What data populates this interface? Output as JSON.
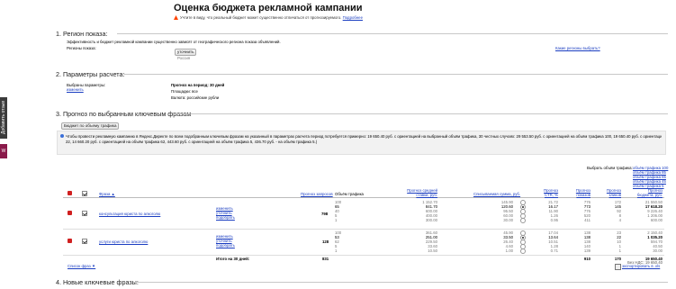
{
  "page": {
    "title": "Оценка бюджета рекламной кампании",
    "warning_text": "Учтите в виду, что реальный бюджет может существенно отличаться от прогнозируемого.",
    "warning_link": "Подробнее"
  },
  "side_tabs": {
    "feedback": "Добавить отзыв",
    "badge": "W"
  },
  "region": {
    "heading": "1. Регион показа:",
    "description": "Эффективность и бюджет рекламной кампании существенно зависят от географического региона показа объявлений.",
    "label": "Регионы показа:",
    "refine_btn": "уточнить",
    "value": "Россия",
    "right_link": "Какие регионы выбрать?"
  },
  "params": {
    "heading": "2. Параметры расчета:",
    "selected_label": "Выбраны параметры:",
    "change_link": "изменить",
    "forecast_period": "Прогноз на период: 30 дней",
    "platforms": "Площадки: все",
    "currency": "Валюта: российские рубли"
  },
  "forecast": {
    "heading": "3. Прогноз по выбранным ключевым фразам",
    "by_traffic_btn": "Бюджет по объему трафика",
    "notice_line1": "Чтобы провести рекламную кампанию в Яндекс.Директе по всем подобранным ключевым фразам на указанный в параметрах расчета период потребуется примерно: 19 650.40 руб. с ориентацией на выбранный объём трафика, 30 честных случаях: 29 553.50 руб. с ориентацией на объём трафика 100, 19 650.40 руб. с ориентацией на объём трафика",
    "notice_line2": "22, 14 660.20 руб. с ориентацией на объём трафика 62, 443.60 руб. с ориентацией на объём трафика 5, 436.70 руб. - на объём трафика 5.)",
    "choose_traffic_label": "Выбрать объём трафика:",
    "traffic_links": [
      "объём трафика 100",
      "объём трафика 85",
      "объём трафика 65",
      "объём трафика 45",
      "объём трафика 5"
    ],
    "columns": {
      "phrase": "Фраза ▲",
      "searches": "Прогноз запросов",
      "traffic": "Объём трафика",
      "avg_cost": "Прогноз средней ставки, руб.",
      "write_off": "Списываемая сумма, руб.",
      "ctr": "Прогноз CTR, %",
      "clicks": "Прогноз показов",
      "clicks2": "Прогноз кликов",
      "budget": "Прогноз бюджета, руб."
    },
    "rows": [
      {
        "phrase": "консультация юриста по алкоголю",
        "actions": [
          "изменить",
          "уточнить",
          "подобрать"
        ],
        "searches": "798",
        "traffic": [
          "100",
          "65",
          "40",
          "5",
          "1"
        ],
        "avg_cost": [
          "1 152.70",
          "841.70",
          "600.00",
          "400.00",
          "300.00"
        ],
        "write_off": [
          "145.90",
          "120.60",
          "95.50",
          "60.00",
          "30.00"
        ],
        "ctr": [
          "21.72",
          "16.17",
          "11.90",
          "1.26",
          "0.95"
        ],
        "shows": [
          "776",
          "773",
          "776",
          "520",
          "411"
        ],
        "clicks": [
          "172",
          "145",
          "92",
          "8",
          "4"
        ],
        "budget": [
          "21 550.50",
          "17 618.20",
          "9 226.40",
          "1 206.00",
          "600.00"
        ]
      },
      {
        "phrase": "услуги юриста по алкоголю",
        "actions": [
          "изменить",
          "уточнить",
          "подобрать"
        ],
        "searches": "128",
        "traffic": [
          "100",
          "53",
          "62",
          "5",
          "1"
        ],
        "avg_cost": [
          "361.60",
          "251.00",
          "229.50",
          "33.60",
          "10.50"
        ],
        "write_off": [
          "45.90",
          "33.50",
          "26.40",
          "4.60",
          "1.00"
        ],
        "ctr": [
          "17.04",
          "13.64",
          "10.51",
          "1.28",
          "0.71"
        ],
        "shows": [
          "138",
          "138",
          "138",
          "140",
          "139"
        ],
        "clicks": [
          "23",
          "22",
          "10",
          "1",
          "1"
        ],
        "budget": [
          "2 150.40",
          "1 035.20",
          "594.70",
          "40.50",
          "30.00"
        ]
      }
    ],
    "selected_traffic_index": 1,
    "totals": {
      "label": "Итого на 30 дней:",
      "searches": "831",
      "clicks": "910",
      "clicks2": "170",
      "budget": "19 650.40"
    },
    "phrase_list_link": "Список фраз ▼",
    "vat_note": "Без НДС: 19 650.40",
    "excel_link": "экспортировать в .xls"
  },
  "new_phrases": {
    "heading": "4. Новые ключевые фразы:"
  },
  "colors": {
    "link": "#1a3dc1",
    "delete": "#d02020",
    "warning": "#ff4400"
  }
}
